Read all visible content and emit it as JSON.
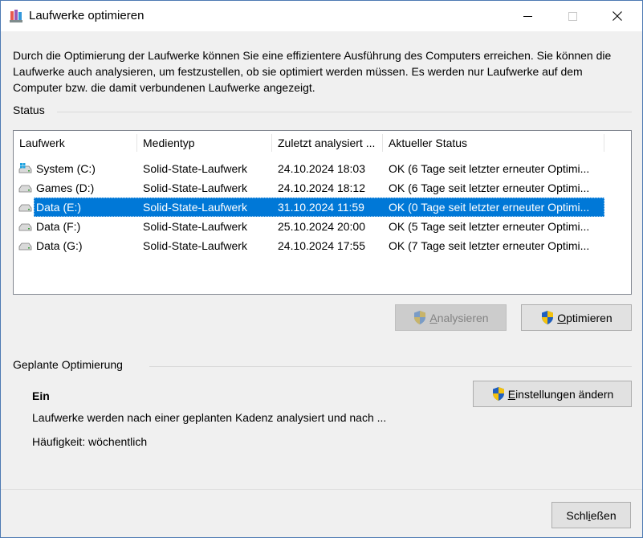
{
  "window": {
    "title": "Laufwerke optimieren",
    "controls": {
      "minimize_icon": "minimize-icon",
      "maximize_icon": "maximize-icon",
      "close_icon": "close-icon"
    }
  },
  "intro_text": "Durch die Optimierung der Laufwerke können Sie eine effizientere Ausführung des Computers erreichen. Sie können die Laufwerke auch analysieren, um festzustellen, ob sie optimiert werden müssen. Es werden nur Laufwerke auf dem Computer bzw. die damit verbundenen Laufwerke angezeigt.",
  "status": {
    "label": "Status",
    "columns": [
      "Laufwerk",
      "Medientyp",
      "Zuletzt analysiert ...",
      "Aktueller Status"
    ],
    "rows": [
      {
        "drive": "System (C:)",
        "media": "Solid-State-Laufwerk",
        "last": "24.10.2024 18:03",
        "state": "OK (6 Tage seit letzter erneuter Optimi...",
        "icon": "windows-drive-icon",
        "selected": false
      },
      {
        "drive": "Games (D:)",
        "media": "Solid-State-Laufwerk",
        "last": "24.10.2024 18:12",
        "state": "OK (6 Tage seit letzter erneuter Optimi...",
        "icon": "drive-icon",
        "selected": false
      },
      {
        "drive": "Data (E:)",
        "media": "Solid-State-Laufwerk",
        "last": "31.10.2024 11:59",
        "state": "OK (0 Tage seit letzter erneuter Optimi...",
        "icon": "drive-icon",
        "selected": true
      },
      {
        "drive": "Data (F:)",
        "media": "Solid-State-Laufwerk",
        "last": "25.10.2024 20:00",
        "state": "OK (5 Tage seit letzter erneuter Optimi...",
        "icon": "drive-icon",
        "selected": false
      },
      {
        "drive": "Data (G:)",
        "media": "Solid-State-Laufwerk",
        "last": "24.10.2024 17:55",
        "state": "OK (7 Tage seit letzter erneuter Optimi...",
        "icon": "drive-icon",
        "selected": false
      }
    ],
    "analyze_button": {
      "accel": "A",
      "rest": "nalysieren",
      "enabled": false
    },
    "optimize_button": {
      "accel": "O",
      "rest": "ptimieren",
      "enabled": true
    }
  },
  "scheduled": {
    "label": "Geplante Optimierung",
    "state": "Ein",
    "description": "Laufwerke werden nach einer geplanten Kadenz analysiert und nach ...",
    "frequency": "Häufigkeit: wöchentlich",
    "settings_button": {
      "accel": "E",
      "rest": "instellungen ändern"
    }
  },
  "close_button": {
    "pre": "Schl",
    "accel": "i",
    "rest": "eßen"
  },
  "colors": {
    "selection": "#0078d7",
    "window_bg": "#f0f0f0",
    "list_bg": "#ffffff"
  }
}
